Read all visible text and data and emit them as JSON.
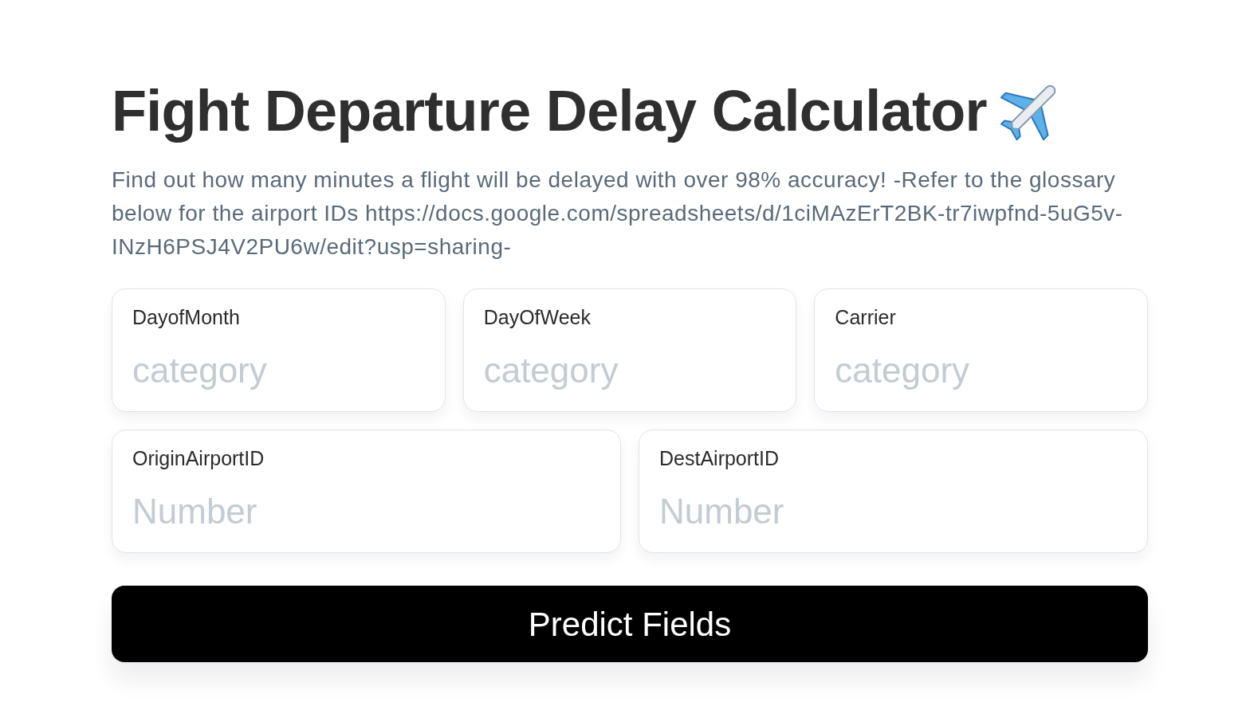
{
  "title": "Fight Departure Delay Calculator",
  "description": "Find out how many minutes a flight will be delayed with over 98% accuracy! -Refer to the glossary below for the airport IDs https://docs.google.com/spreadsheets/d/1ciMAzErT2BK-tr7iwpfnd-5uG5v-INzH6PSJ4V2PU6w/edit?usp=sharing-",
  "field_rows": [
    {
      "fields": [
        {
          "label": "DayofMonth",
          "placeholder": "category"
        },
        {
          "label": "DayOfWeek",
          "placeholder": "category"
        },
        {
          "label": "Carrier",
          "placeholder": "category"
        }
      ]
    },
    {
      "fields": [
        {
          "label": "OriginAirportID",
          "placeholder": "Number"
        },
        {
          "label": "DestAirportID",
          "placeholder": "Number"
        }
      ]
    }
  ],
  "submit_button": {
    "label": "Predict Fields"
  }
}
